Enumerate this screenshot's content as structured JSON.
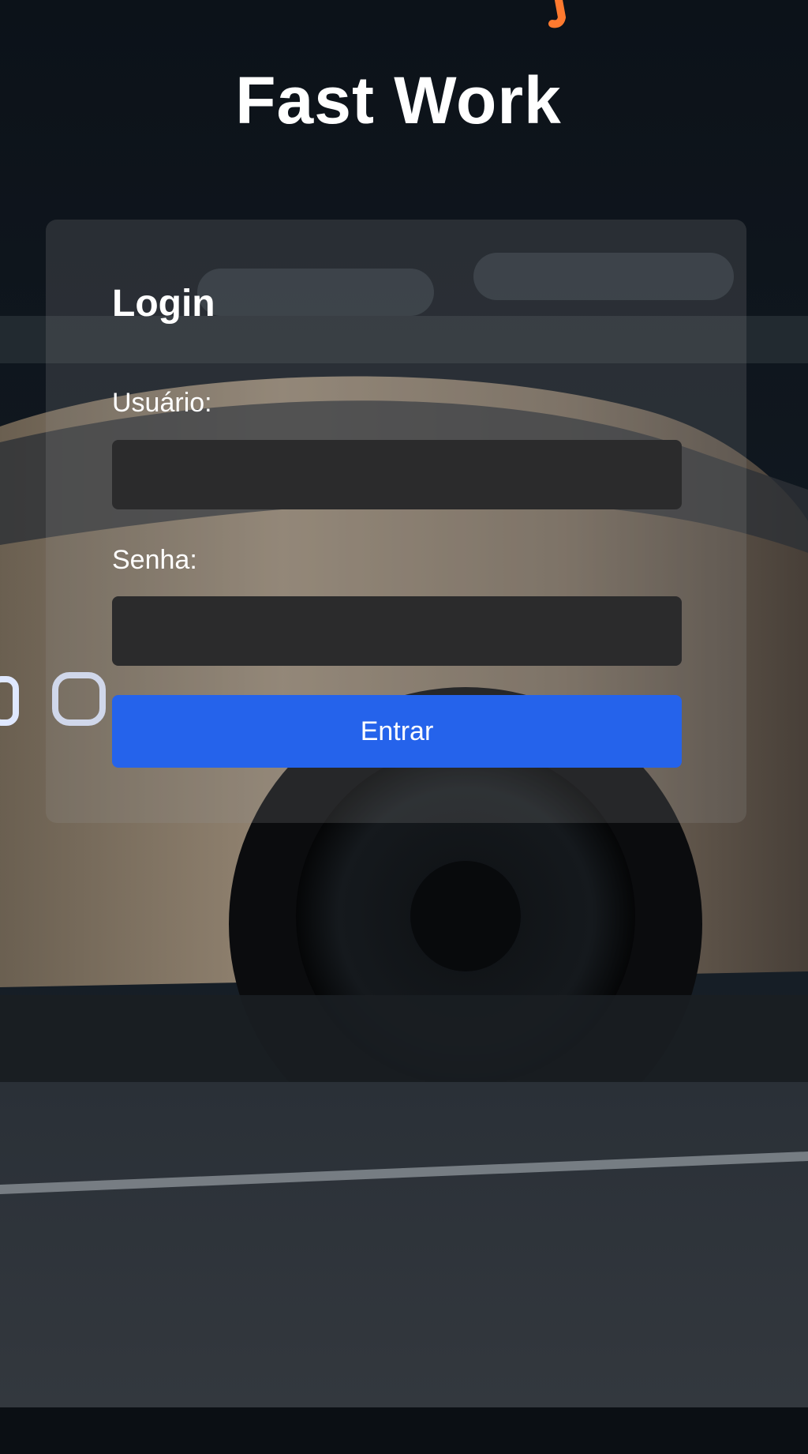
{
  "header": {
    "app_title": "Fast Work"
  },
  "login_card": {
    "heading": "Login",
    "username_label": "Usuário:",
    "username_value": "",
    "password_label": "Senha:",
    "password_value": "",
    "submit_label": "Entrar"
  },
  "colors": {
    "button": "#2563eb",
    "input_background": "#2b2b2c",
    "text": "#ffffff",
    "accent_mark": "#ff7a2f"
  }
}
